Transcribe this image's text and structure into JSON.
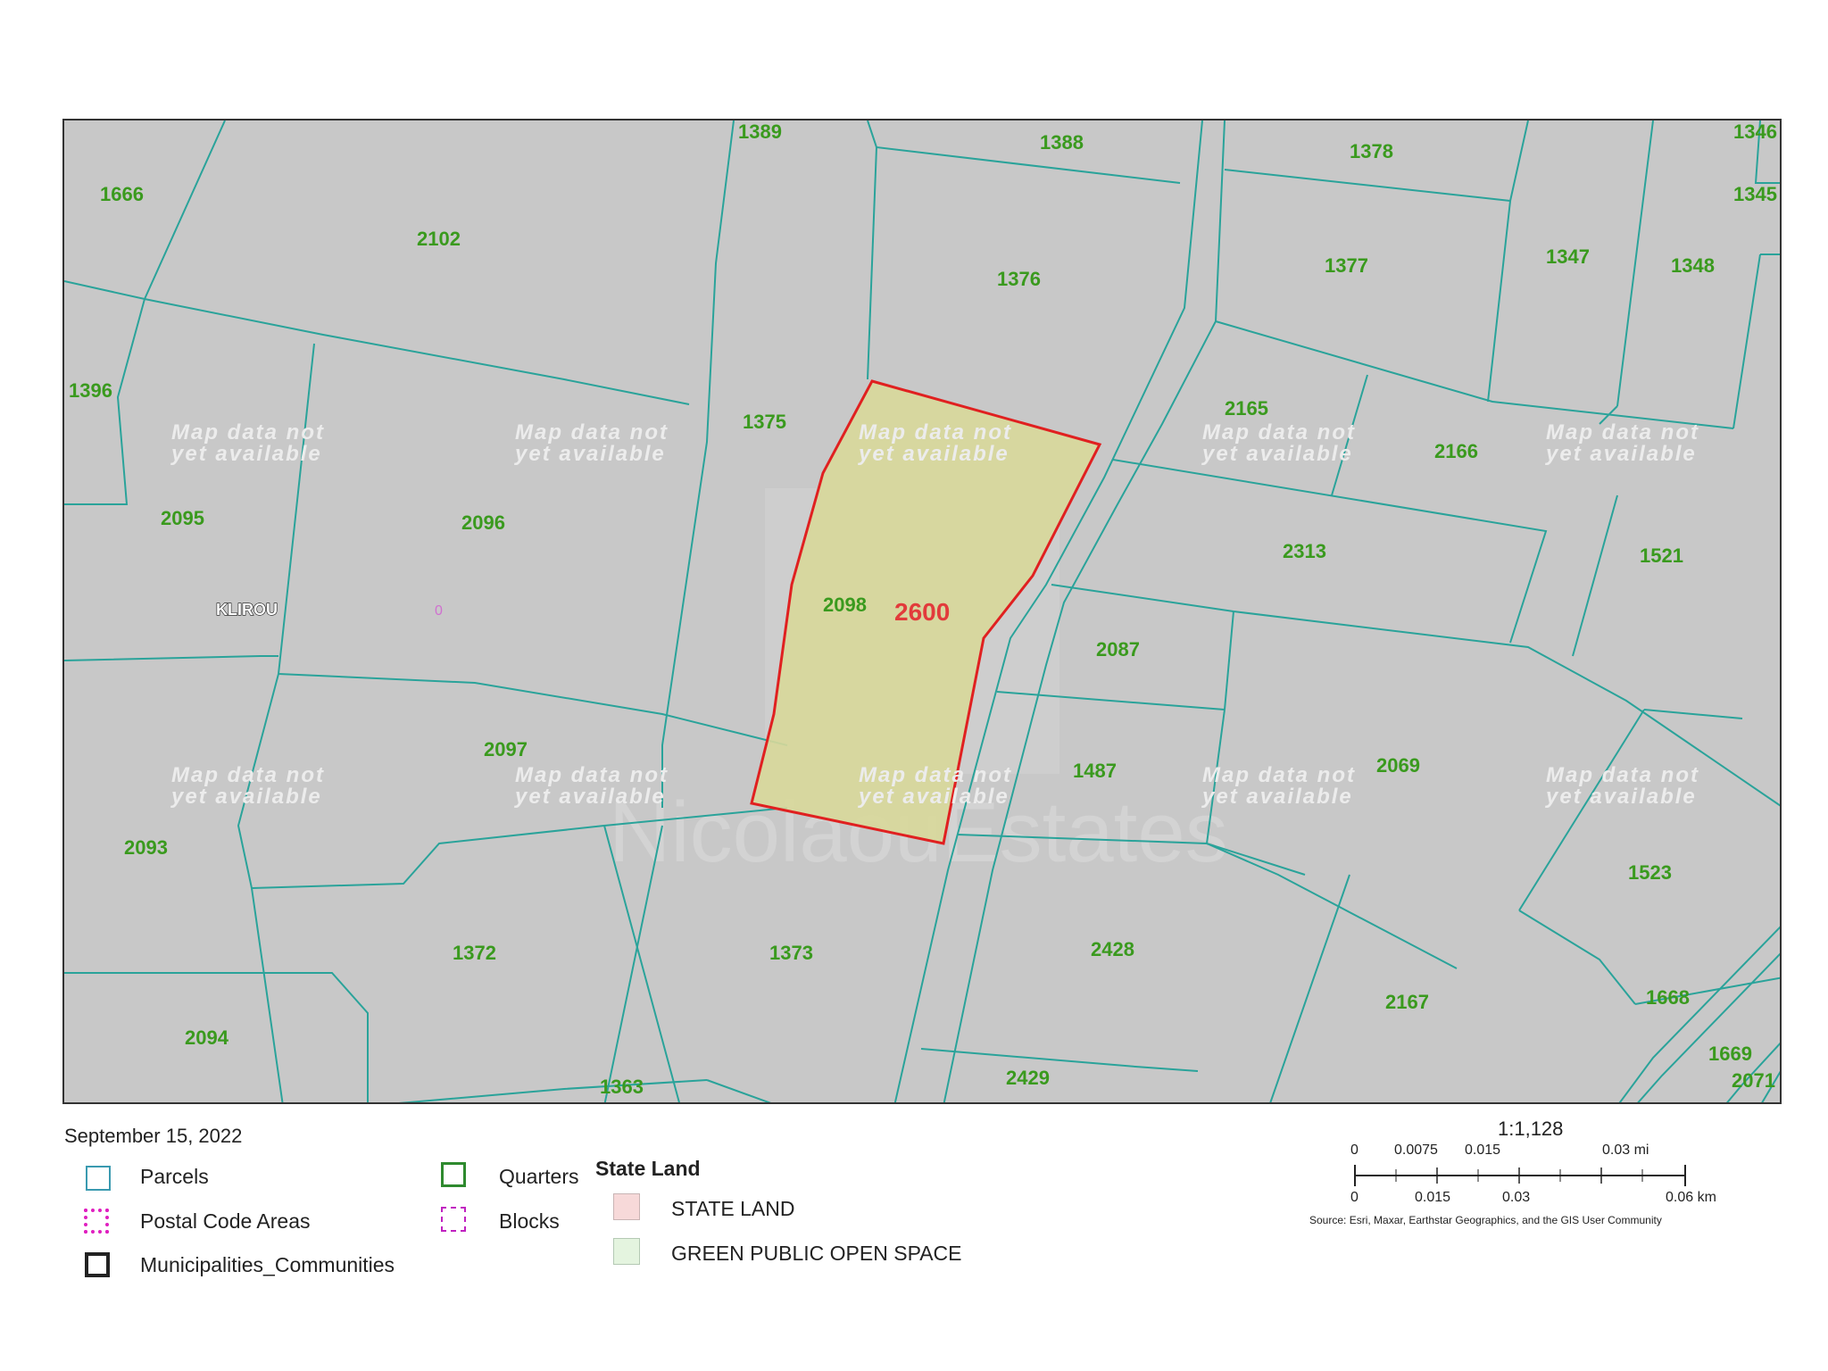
{
  "map": {
    "parcels": [
      {
        "id": "1666"
      },
      {
        "id": "2102"
      },
      {
        "id": "1389"
      },
      {
        "id": "1388"
      },
      {
        "id": "1378"
      },
      {
        "id": "1346"
      },
      {
        "id": "1345"
      },
      {
        "id": "1376"
      },
      {
        "id": "1377"
      },
      {
        "id": "1347"
      },
      {
        "id": "1348"
      },
      {
        "id": "1396"
      },
      {
        "id": "1375"
      },
      {
        "id": "2165"
      },
      {
        "id": "2166"
      },
      {
        "id": "2095"
      },
      {
        "id": "2096"
      },
      {
        "id": "2313"
      },
      {
        "id": "1521"
      },
      {
        "id": "2098"
      },
      {
        "id": "2087"
      },
      {
        "id": "2097"
      },
      {
        "id": "1487"
      },
      {
        "id": "2069"
      },
      {
        "id": "2093"
      },
      {
        "id": "1523"
      },
      {
        "id": "1372"
      },
      {
        "id": "1373"
      },
      {
        "id": "2428"
      },
      {
        "id": "2167"
      },
      {
        "id": "1668"
      },
      {
        "id": "2094"
      },
      {
        "id": "1669"
      },
      {
        "id": "2071"
      },
      {
        "id": "1363"
      },
      {
        "id": "2429"
      }
    ],
    "nodata_text": [
      "Map data not",
      "yet available"
    ],
    "highlighted_parcel": "2600",
    "locality_label": "KLIROU",
    "block_label": "0",
    "watermark": "NicolaouEstates"
  },
  "footer": {
    "date": "September 15, 2022",
    "legend": {
      "parcels": "Parcels",
      "postal_code_areas": "Postal Code Areas",
      "municipalities": "Municipalities_Communities",
      "quarters": "Quarters",
      "blocks": "Blocks",
      "state_land_title": "State Land",
      "state_land": "STATE LAND",
      "green_space": "GREEN PUBLIC OPEN SPACE"
    },
    "scale": {
      "ratio": "1:1,128",
      "mi_ticks": [
        "0",
        "0.0075",
        "0.015",
        "0.03 mi"
      ],
      "km_ticks": [
        "0",
        "0.015",
        "0.03",
        "0.06 km"
      ],
      "source": "Source: Esri, Maxar, Earthstar Geographics, and the GIS User Community"
    }
  },
  "colors": {
    "map_background": "#c8c8c8",
    "parcel_line": "#2aa39a",
    "parcel_label": "#3a9a1e",
    "highlight_fill": "#d8d89a",
    "highlight_stroke": "#e02020",
    "state_land_swatch": "#f7d9d9",
    "green_space_swatch": "#e4f4df"
  }
}
